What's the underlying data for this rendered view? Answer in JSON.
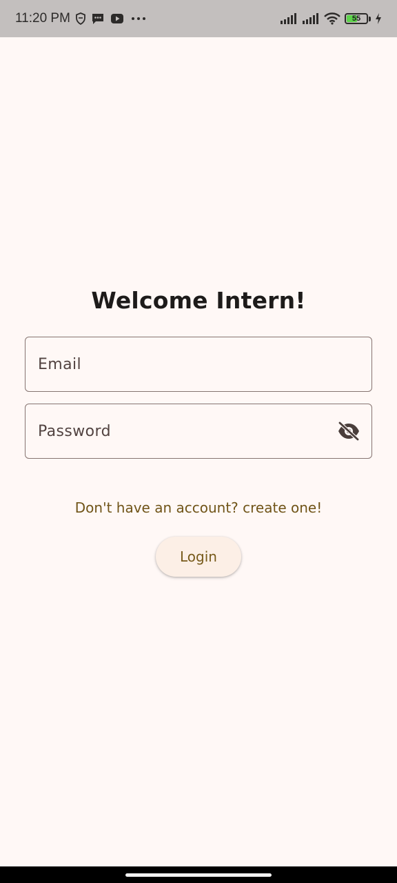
{
  "status_bar": {
    "time": "11:20 PM",
    "battery_level": "55",
    "battery_fraction": 0.55,
    "left_icons": [
      "shield-notification-icon",
      "message-icon",
      "youtube-icon",
      "more-dots-icon"
    ],
    "right_icons": [
      "signal-icon",
      "signal-icon",
      "wifi-icon",
      "battery-icon",
      "charging-icon"
    ],
    "battery_color": "#5dd34b"
  },
  "login": {
    "title": "Welcome Intern!",
    "email_placeholder": "Email",
    "password_placeholder": "Password",
    "password_toggle_icon": "eye-off-icon",
    "signup_link": "Don't have an account? create one!",
    "login_button": "Login"
  },
  "colors": {
    "background": "#fff8f6",
    "accent": "#775a1a",
    "button_bg": "#fcefe6",
    "border": "#857370"
  }
}
